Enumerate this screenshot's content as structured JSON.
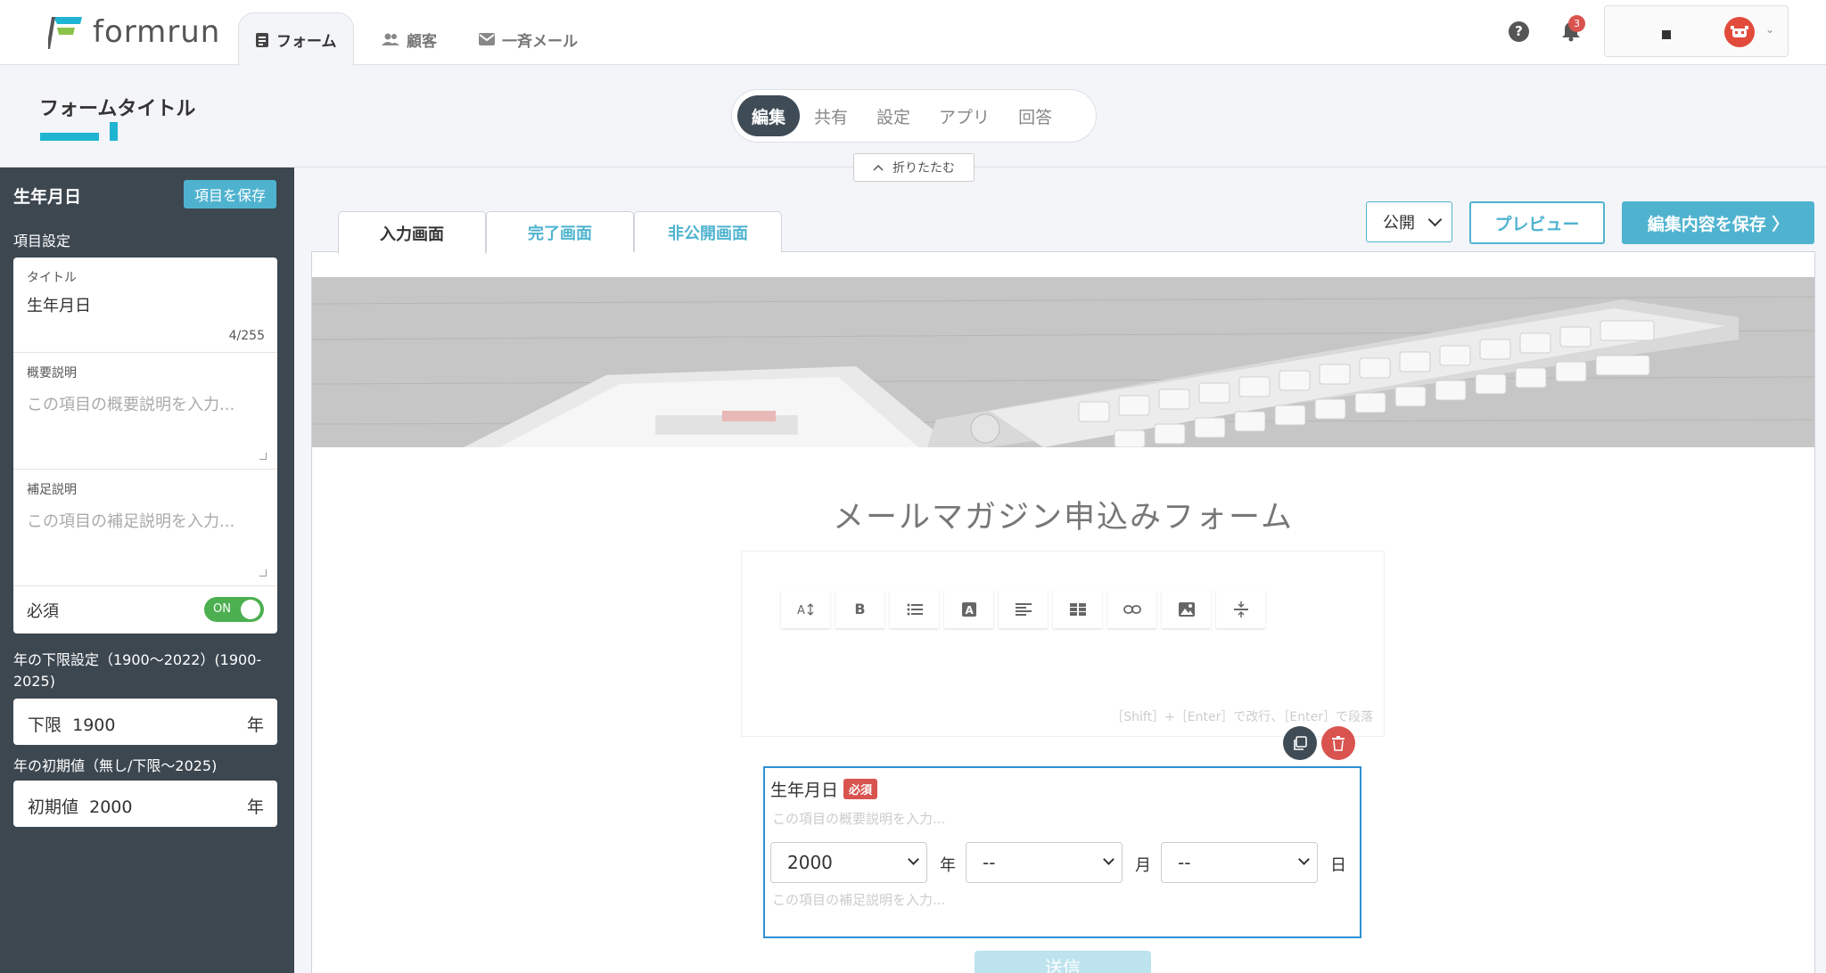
{
  "header": {
    "logo_text": "formrun",
    "nav": [
      {
        "label": "フォーム",
        "icon": "document-icon",
        "active": true
      },
      {
        "label": "顧客",
        "icon": "people-icon",
        "active": false
      },
      {
        "label": "一斉メール",
        "icon": "mail-icon",
        "active": false
      }
    ],
    "help_label": "?",
    "notification_count": "3",
    "user_initial": "■"
  },
  "form_header": {
    "title": "フォームタイトル",
    "pills": [
      "編集",
      "共有",
      "設定",
      "アプリ",
      "回答"
    ],
    "active_pill": "編集",
    "collapse_label": "折りたたむ"
  },
  "sidebar": {
    "title": "生年月日",
    "save_label": "項目を保存",
    "section_label": "項目設定",
    "title_field": {
      "label": "タイトル",
      "value": "生年月日",
      "count": "4/255"
    },
    "summary_field": {
      "label": "概要説明",
      "placeholder": "この項目の概要説明を入力..."
    },
    "supplement_field": {
      "label": "補足説明",
      "placeholder": "この項目の補足説明を入力..."
    },
    "required": {
      "label": "必須",
      "toggle": "ON"
    },
    "year_min_label": "年の下限設定（1900〜2022）(1900-2025)",
    "year_min": {
      "prefix": "下限",
      "value": "1900",
      "suffix": "年"
    },
    "year_init_label": "年の初期値（無し/下限〜2025)",
    "year_init": {
      "prefix": "初期値",
      "value": "2000",
      "suffix": "年"
    }
  },
  "main": {
    "tabs": [
      "入力画面",
      "完了画面",
      "非公開画面"
    ],
    "active_tab": "入力画面",
    "visibility": "公開",
    "preview_label": "プレビュー",
    "save_label": "編集内容を保存 〉",
    "form_title": "メールマガジン申込みフォーム",
    "rte_tools": [
      "A↕",
      "B",
      "list",
      "A",
      "align",
      "table",
      "link",
      "image",
      "divider"
    ],
    "rte_hint": "［Shift］+［Enter］で改行、［Enter］で段落",
    "field": {
      "title": "生年月日",
      "required_badge": "必須",
      "summary_placeholder": "この項目の概要説明を入力...",
      "supplement_placeholder": "この項目の補足説明を入力...",
      "year_value": "2000",
      "year_unit": "年",
      "month_value": "--",
      "month_unit": "月",
      "day_value": "--",
      "day_unit": "日"
    },
    "submit_label": "送信"
  },
  "colors": {
    "accent": "#4fb3cf",
    "sidebar_bg": "#3c4750",
    "danger": "#d9534f",
    "toggle_on": "#4caf50",
    "field_border": "#2d8fd5"
  }
}
